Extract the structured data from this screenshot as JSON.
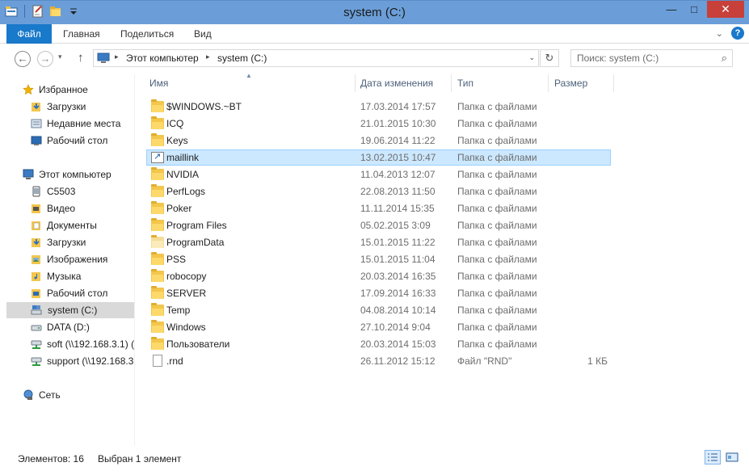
{
  "window": {
    "title": "system (C:)",
    "minimize_glyph": "—",
    "maximize_glyph": "□",
    "close_glyph": "✕"
  },
  "ribbon": {
    "tabs": [
      "Файл",
      "Главная",
      "Поделиться",
      "Вид"
    ],
    "active_tab": "Файл",
    "help_glyph": "?",
    "expand_glyph": "⌄"
  },
  "nav": {
    "back_glyph": "←",
    "forward_glyph": "→",
    "recent_glyph": "▾",
    "up_glyph": "↑",
    "breadcrumb": [
      "Этот компьютер",
      "system (C:)"
    ],
    "breadcrumb_sep": "▸",
    "dropdown_glyph": "⌄",
    "refresh_glyph": "↻",
    "search_placeholder": "Поиск: system (C:)",
    "search_glyph": "⌕"
  },
  "navpane": {
    "favorites": {
      "label": "Избранное",
      "icon": "star-icon",
      "items": [
        {
          "label": "Загрузки",
          "icon": "downloads-folder-icon"
        },
        {
          "label": "Недавние места",
          "icon": "recent-places-icon"
        },
        {
          "label": "Рабочий стол",
          "icon": "desktop-icon"
        }
      ]
    },
    "computer": {
      "label": "Этот компьютер",
      "icon": "computer-icon",
      "items": [
        {
          "label": "C5503",
          "icon": "device-icon"
        },
        {
          "label": "Видео",
          "icon": "videos-folder-icon"
        },
        {
          "label": "Документы",
          "icon": "documents-folder-icon"
        },
        {
          "label": "Загрузки",
          "icon": "downloads-folder-icon"
        },
        {
          "label": "Изображения",
          "icon": "pictures-folder-icon"
        },
        {
          "label": "Музыка",
          "icon": "music-folder-icon"
        },
        {
          "label": "Рабочий стол",
          "icon": "desktop-folder-icon"
        },
        {
          "label": "system (C:)",
          "icon": "system-drive-icon",
          "selected": true
        },
        {
          "label": "DATA (D:)",
          "icon": "drive-icon"
        },
        {
          "label": "soft (\\\\192.168.3.1) (",
          "icon": "network-drive-icon"
        },
        {
          "label": "support (\\\\192.168.3",
          "icon": "network-drive-icon"
        }
      ]
    },
    "network": {
      "label": "Сеть",
      "icon": "network-icon"
    }
  },
  "columns": {
    "name": "Имя",
    "date": "Дата изменения",
    "type": "Тип",
    "size": "Размер",
    "sort_glyph": "▲"
  },
  "files": [
    {
      "name": "$WINDOWS.~BT",
      "date": "17.03.2014 17:57",
      "type": "Папка с файлами",
      "size": "",
      "icon": "folder-icon"
    },
    {
      "name": "ICQ",
      "date": "21.01.2015 10:30",
      "type": "Папка с файлами",
      "size": "",
      "icon": "folder-icon"
    },
    {
      "name": "Keys",
      "date": "19.06.2014 11:22",
      "type": "Папка с файлами",
      "size": "",
      "icon": "folder-icon"
    },
    {
      "name": "maillink",
      "date": "13.02.2015 10:47",
      "type": "Папка с файлами",
      "size": "",
      "icon": "shortcut-folder-icon",
      "selected": true
    },
    {
      "name": "NVIDIA",
      "date": "11.04.2013 12:07",
      "type": "Папка с файлами",
      "size": "",
      "icon": "folder-icon"
    },
    {
      "name": "PerfLogs",
      "date": "22.08.2013 11:50",
      "type": "Папка с файлами",
      "size": "",
      "icon": "folder-icon"
    },
    {
      "name": "Poker",
      "date": "11.11.2014 15:35",
      "type": "Папка с файлами",
      "size": "",
      "icon": "folder-icon"
    },
    {
      "name": "Program Files",
      "date": "05.02.2015 3:09",
      "type": "Папка с файлами",
      "size": "",
      "icon": "folder-icon"
    },
    {
      "name": "ProgramData",
      "date": "15.01.2015 11:22",
      "type": "Папка с файлами",
      "size": "",
      "icon": "hidden-folder-icon"
    },
    {
      "name": "PSS",
      "date": "15.01.2015 11:04",
      "type": "Папка с файлами",
      "size": "",
      "icon": "folder-icon"
    },
    {
      "name": "robocopy",
      "date": "20.03.2014 16:35",
      "type": "Папка с файлами",
      "size": "",
      "icon": "folder-icon"
    },
    {
      "name": "SERVER",
      "date": "17.09.2014 16:33",
      "type": "Папка с файлами",
      "size": "",
      "icon": "folder-icon"
    },
    {
      "name": "Temp",
      "date": "04.08.2014 10:14",
      "type": "Папка с файлами",
      "size": "",
      "icon": "folder-icon"
    },
    {
      "name": "Windows",
      "date": "27.10.2014 9:04",
      "type": "Папка с файлами",
      "size": "",
      "icon": "folder-icon"
    },
    {
      "name": "Пользователи",
      "date": "20.03.2014 15:03",
      "type": "Папка с файлами",
      "size": "",
      "icon": "folder-icon"
    },
    {
      "name": ".rnd",
      "date": "26.11.2012 15:12",
      "type": "Файл \"RND\"",
      "size": "1 КБ",
      "icon": "file-icon"
    }
  ],
  "status": {
    "count": "Элементов: 16",
    "selection": "Выбран 1 элемент"
  },
  "colors": {
    "titlebar": "#6b9ed8",
    "file_tab": "#1979ca",
    "close_button": "#c7403a",
    "selection_fill": "#cce8ff",
    "selection_border": "#99d1ff",
    "folder": "#f3c64c"
  }
}
